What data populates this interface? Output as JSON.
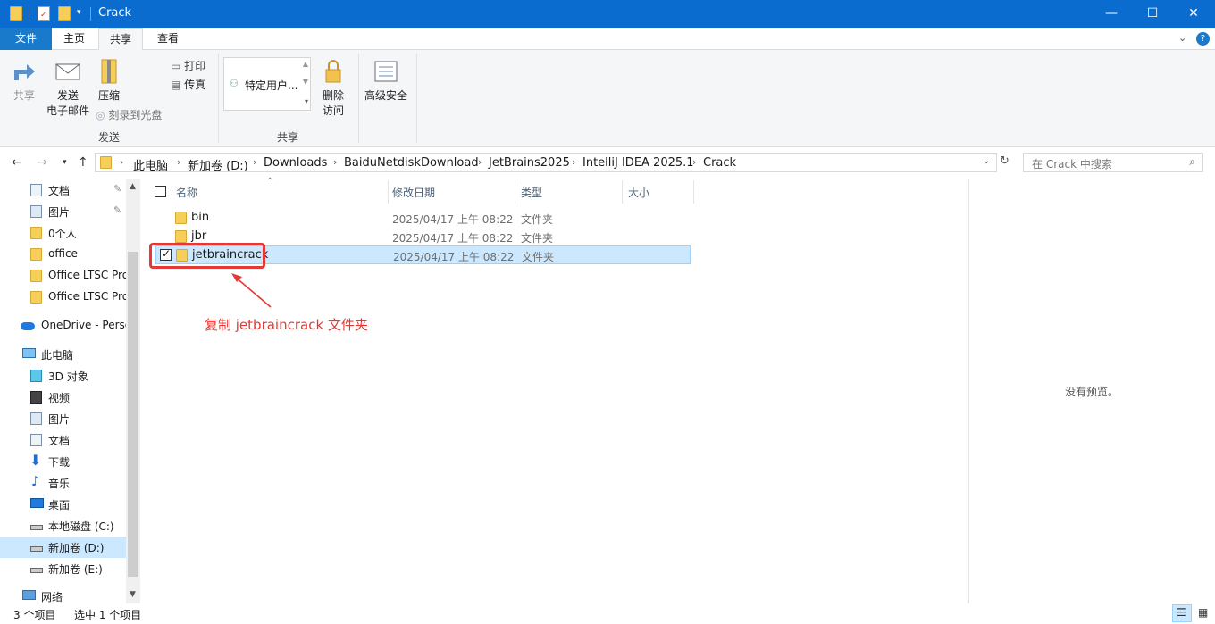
{
  "window": {
    "title": "Crack",
    "minimize": "—",
    "maximize": "☐",
    "close": "✕"
  },
  "tabs": {
    "file": "文件",
    "home": "主页",
    "share": "共享",
    "view": "查看"
  },
  "ribbon": {
    "share": "共享",
    "email_line1": "发送",
    "email_line2": "电子邮件",
    "zip": "压缩",
    "print": "打印",
    "fax": "传真",
    "burn": "刻录到光盘",
    "group_send": "发送",
    "specific_users": "特定用户...",
    "group_share": "共享",
    "remove_access_line1": "删除",
    "remove_access_line2": "访问",
    "advanced_security": "高级安全"
  },
  "address": {
    "crumbs": [
      "此电脑",
      "新加卷 (D:)",
      "Downloads",
      "BaiduNetdiskDownload",
      "JetBrains2025",
      "IntelliJ IDEA 2025.1",
      "Crack"
    ],
    "search_placeholder": "在 Crack 中搜索"
  },
  "nav": {
    "quick": [
      "文档",
      "图片",
      "0个人",
      "office",
      "Office LTSC Pro",
      "Office LTSC Pro"
    ],
    "onedrive": "OneDrive - Personal",
    "this_pc": "此电脑",
    "pc_items": [
      "3D 对象",
      "视频",
      "图片",
      "文档",
      "下载",
      "音乐",
      "桌面",
      "本地磁盘 (C:)",
      "新加卷 (D:)",
      "新加卷 (E:)"
    ],
    "network": "网络"
  },
  "columns": {
    "name": "名称",
    "date": "修改日期",
    "type": "类型",
    "size": "大小"
  },
  "files": [
    {
      "name": "bin",
      "date": "2025/04/17 上午 08:22",
      "type": "文件夹"
    },
    {
      "name": "jbr",
      "date": "2025/04/17 上午 08:22",
      "type": "文件夹"
    },
    {
      "name": "jetbraincrack",
      "date": "2025/04/17 上午 08:22",
      "type": "文件夹"
    }
  ],
  "annotation": "复制 jetbraincrack 文件夹",
  "preview": {
    "empty": "没有预览。"
  },
  "status": {
    "count": "3 个项目",
    "selected": "选中 1 个项目"
  },
  "colors": {
    "titlebar": "#0b6cd0",
    "selection": "#cce8ff",
    "annotation": "#e53935"
  }
}
